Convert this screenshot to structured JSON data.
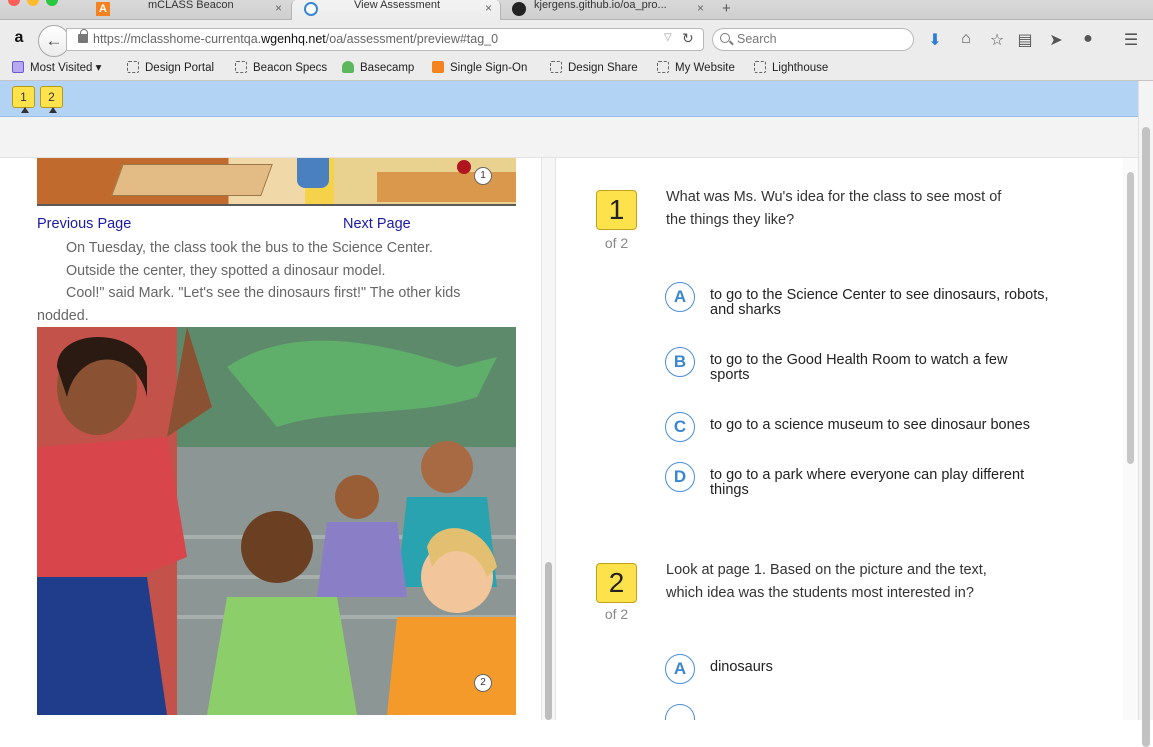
{
  "browser": {
    "tabs": [
      {
        "title": "mCLASS Beacon",
        "active": false
      },
      {
        "title": "View Assessment",
        "active": true
      },
      {
        "title": "kjergens.github.io/oa_pro...",
        "active": false
      }
    ],
    "url": {
      "prefix": "https://mclasshome-currentqa.",
      "host": "wgenhq.net",
      "path": "/oa/assessment/preview#tag_0"
    },
    "search_placeholder": "Search",
    "bookmarks": [
      "Most Visited",
      "Design Portal",
      "Beacon Specs",
      "Basecamp",
      "Single Sign-On",
      "Design Share",
      "My Website",
      "Lighthouse"
    ]
  },
  "question_chips": [
    "1",
    "2"
  ],
  "story": {
    "previous_label": "Previous Page",
    "next_label": "Next Page",
    "paragraphs": [
      "On Tuesday, the class took the bus to the Science Center.",
      "Outside the center, they spotted a dinosaur model.",
      "Cool!\" said Mark. \"Let's see the dinosaurs first!\" The other kids nodded."
    ],
    "page_markers": [
      "1",
      "2"
    ]
  },
  "questions": [
    {
      "number": "1",
      "of": "of 2",
      "text": "What was Ms. Wu's idea for the class to see most of the things they like?",
      "options": [
        {
          "letter": "A",
          "text": "to go to the Science Center to see dinosaurs, robots, and sharks"
        },
        {
          "letter": "B",
          "text": "to go to the Good Health Room to watch a few sports"
        },
        {
          "letter": "C",
          "text": "to go to a science museum to see dinosaur bones"
        },
        {
          "letter": "D",
          "text": "to go to a park where everyone can play different things"
        }
      ]
    },
    {
      "number": "2",
      "of": "of 2",
      "text": "Look at page 1. Based on the picture and the text, which idea was the students most interested in?",
      "options": [
        {
          "letter": "A",
          "text": "dinosaurs"
        }
      ]
    }
  ],
  "colors": {
    "accent_blue": "#3b86d0",
    "chip_yellow": "#fde24b",
    "toolbar_blue": "#b3d3f5",
    "link": "#1a1aa6"
  }
}
